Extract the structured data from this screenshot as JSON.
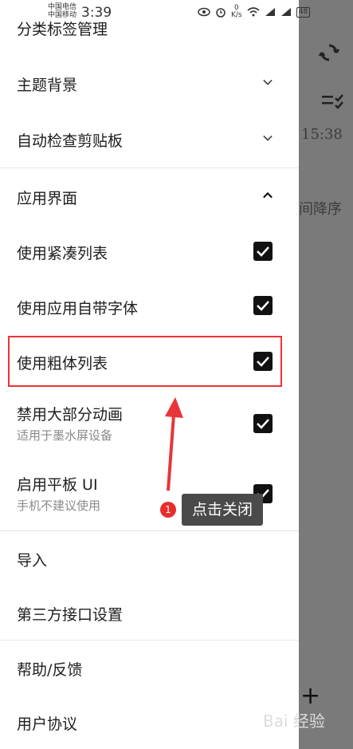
{
  "status_bar": {
    "carrier_line1": "中国电信",
    "carrier_line2": "中国移动",
    "time": "3:39",
    "net_speed_value": "0",
    "net_speed_unit": "K/s",
    "battery": "48"
  },
  "background_app": {
    "timestamp": "15:38",
    "sort_text": "间降序",
    "add_symbol": "+"
  },
  "drawer": {
    "items": [
      {
        "label": "分类标签管理"
      },
      {
        "label": "主题背景",
        "chevron": "down"
      },
      {
        "label": "自动检查剪贴板",
        "chevron": "down"
      },
      {
        "label": "应用界面",
        "chevron": "up"
      },
      {
        "label": "使用紧凑列表",
        "checked": true
      },
      {
        "label": "使用应用自带字体",
        "checked": true
      },
      {
        "label": "使用粗体列表",
        "checked": true
      },
      {
        "label": "禁用大部分动画",
        "sub": "适用于墨水屏设备",
        "checked": true
      },
      {
        "label": "启用平板 UI",
        "sub": "手机不建议使用",
        "checked": true
      },
      {
        "label": "导入"
      },
      {
        "label": "第三方接口设置"
      },
      {
        "label": "帮助/反馈"
      },
      {
        "label": "用户协议"
      }
    ]
  },
  "annotation": {
    "step_number": "1",
    "tooltip": "点击关闭",
    "highlight_color": "#e33333"
  },
  "watermark": "Bai 经验"
}
